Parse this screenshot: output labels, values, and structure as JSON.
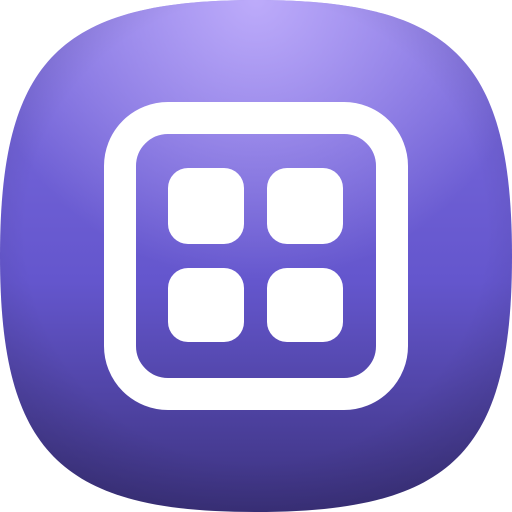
{
  "icon": {
    "name": "grid-app-icon",
    "glyph": "four-square-grid-icon",
    "colors": {
      "background_top": "#7e6ee0",
      "background_mid": "#6456cd",
      "background_bottom": "#3c327e",
      "highlight": "#c8b6ff",
      "foreground": "#ffffff"
    }
  }
}
